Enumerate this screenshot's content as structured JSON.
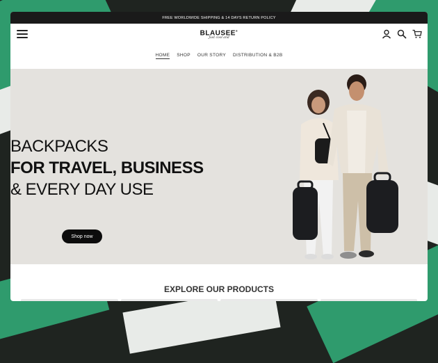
{
  "announcement": "FREE WORLDWIDE SHIPPING & 14 DAYS RETURN POLICY",
  "brand": {
    "name": "BLAUSEE",
    "registered": "®",
    "tagline": "Just cool and"
  },
  "header": {
    "menu_icon": "hamburger-menu-icon",
    "icons": [
      "account-icon",
      "search-icon",
      "cart-icon"
    ]
  },
  "nav": [
    "HOME",
    "SHOP",
    "OUR STORY",
    "DISTRIBUTION & B2B"
  ],
  "hero": {
    "line1": "BACKPACKS",
    "line2": "FOR TRAVEL, BUSINESS",
    "line3": "& EVERY DAY USE",
    "cta": "Shop now"
  },
  "section": {
    "title": "EXPLORE OUR PRODUCTS"
  },
  "colors": {
    "accent_green": "#2f9b6d",
    "hero_bg": "#e4e2de",
    "dark": "#1a1a1a"
  }
}
